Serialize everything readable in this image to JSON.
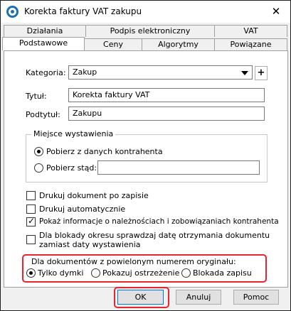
{
  "window": {
    "title": "Korekta faktury VAT zakupu",
    "close_glyph": "✕"
  },
  "tabs": {
    "row_back": [
      "Działania",
      "Podpis elektroniczny",
      "VAT"
    ],
    "row_front": [
      "Podstawowe",
      "Ceny",
      "Algorytmy",
      "Powiązane"
    ],
    "active": "Podstawowe"
  },
  "form": {
    "kategoria_label": "Kategoria:",
    "kategoria_value": "Zakup",
    "plus_label": "+",
    "tytul_label": "Tytuł:",
    "tytul_value": "Korekta faktury VAT",
    "podtytul_label": "Podtytuł:",
    "podtytul_value": "Zakupu"
  },
  "miejsce": {
    "legend": "Miejsce wystawienia",
    "option1": "Pobierz z danych kontrahenta",
    "option1_selected": true,
    "option2": "Pobierz stąd:",
    "option2_value": ""
  },
  "checkboxes": [
    {
      "label": "Drukuj dokument po zapisie",
      "checked": false
    },
    {
      "label": "Drukuj automatycznie",
      "checked": false
    },
    {
      "label": "Pokaż informacje o należnościach i zobowiązaniach kontrahenta",
      "checked": true
    },
    {
      "label_line1": "Dla blokady okresu sprawdzaj datę otrzymania dokumentu",
      "label_line2": "zamiast daty wystawienia",
      "checked": false
    }
  ],
  "duplicate": {
    "heading": "Dla dokumentów z powielonym numerem oryginału:",
    "options": [
      "Tylko dymki",
      "Pokazuj ostrzeżenie",
      "Blokada zapisu"
    ],
    "selected": "Tylko dymki"
  },
  "buttons": {
    "ok": "OK",
    "cancel": "Anuluj",
    "help": "Pomoc"
  },
  "colors": {
    "highlight": "#e8242f",
    "app_icon": "#1a6fb5"
  },
  "icons": {
    "app": "app-logo-icon",
    "close": "close-icon",
    "dropdown": "chevron-down-icon"
  }
}
